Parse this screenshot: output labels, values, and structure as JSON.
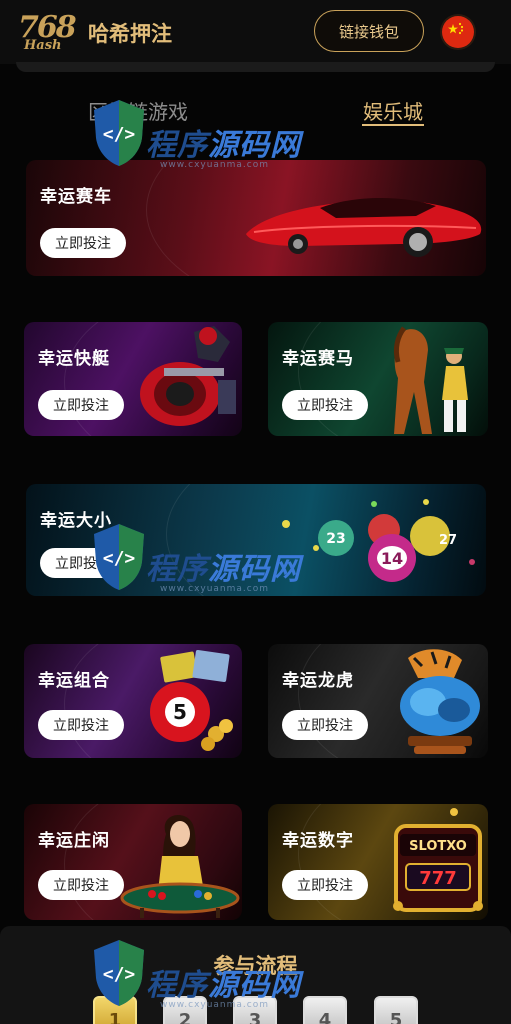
{
  "header": {
    "logo_big": "768",
    "logo_small": "Hash",
    "brand": "哈希押注",
    "wallet_button": "链接钱包",
    "flag_icon": "china-flag-icon"
  },
  "tabs": [
    {
      "label": "区块链游戏",
      "active": false
    },
    {
      "label": "娱乐城",
      "active": true
    }
  ],
  "bet_label": "立即投注",
  "games": [
    {
      "title": "幸运赛车",
      "art": "red-sports-car"
    },
    {
      "title": "幸运快艇",
      "art": "speedboat-racer"
    },
    {
      "title": "幸运赛马",
      "art": "horse-and-jockey"
    },
    {
      "title": "幸运大小",
      "art": "lottery-balls"
    },
    {
      "title": "幸运组合",
      "art": "lottery-ball-tickets"
    },
    {
      "title": "幸运龙虎",
      "art": "tiger-dragon-trophy"
    },
    {
      "title": "幸运庄闲",
      "art": "baccarat-dealer"
    },
    {
      "title": "幸运数字",
      "art": "slot-xo-777"
    }
  ],
  "lottery_balls": [
    "23",
    "14",
    "27"
  ],
  "combo_ball": "5",
  "slot_text": "SLOTXO",
  "slot_digits": "777",
  "process": {
    "title": "参与流程",
    "steps": [
      "1",
      "2",
      "3",
      "4",
      "5"
    ]
  },
  "watermark": {
    "text": "程序源码网",
    "url": "www.cxyuanma.com"
  },
  "colors": {
    "gold": "#e2bd7a",
    "background": "#050505",
    "tab_inactive": "#8d8d8d"
  }
}
